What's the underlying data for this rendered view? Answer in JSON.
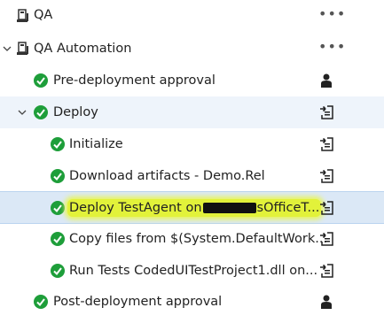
{
  "tree": {
    "env_qa": {
      "label": "QA",
      "icon": "environment-icon",
      "action_icon": "more-ellipsis-icon",
      "action_text": "•••"
    },
    "env_qa_automation": {
      "label": "QA Automation",
      "icon": "environment-icon",
      "action_icon": "more-ellipsis-icon",
      "action_text": "•••",
      "expanded": true
    },
    "pre_approval": {
      "label": "Pre-deployment approval",
      "status": "succeeded",
      "action_icon": "person-icon"
    },
    "deploy": {
      "label": "Deploy",
      "status": "succeeded",
      "expanded": true,
      "action_icon": "log-download-icon"
    },
    "tasks": [
      {
        "label": "Initialize",
        "status": "succeeded",
        "action_icon": "log-download-icon"
      },
      {
        "label": "Download artifacts - Demo.Rel",
        "status": "succeeded",
        "action_icon": "log-download-icon"
      },
      {
        "label_before": "Deploy TestAgent on",
        "label_after": "sOfficeT...",
        "status": "succeeded",
        "action_icon": "log-download-icon",
        "selected": true
      },
      {
        "label": "Copy files from $(System.DefaultWork...",
        "status": "succeeded",
        "action_icon": "log-download-icon"
      },
      {
        "label": "Run Tests CodedUITestProject1.dll on...",
        "status": "succeeded",
        "action_icon": "log-download-icon"
      }
    ],
    "post_approval": {
      "label": "Post-deployment approval",
      "status": "succeeded",
      "action_icon": "person-icon"
    }
  },
  "colors": {
    "success": "#1e9e3a",
    "selected_bg": "#dbe8f6",
    "highlight": "#e2f23a",
    "text": "#222222"
  }
}
